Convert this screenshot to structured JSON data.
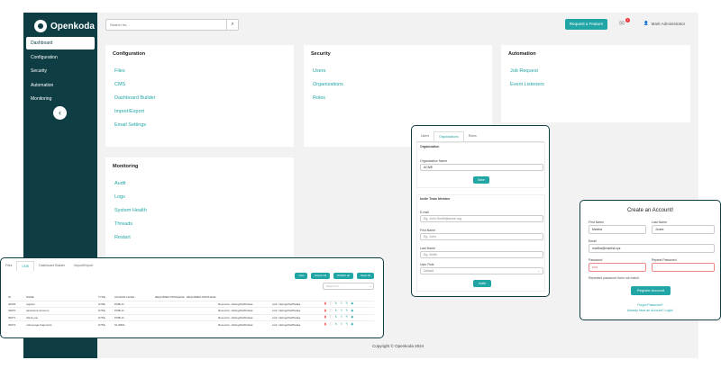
{
  "brand": {
    "name": "Openkoda"
  },
  "sidebar": {
    "items": [
      {
        "label": "Dashboard"
      },
      {
        "label": "Configuration"
      },
      {
        "label": "Security"
      },
      {
        "label": "Automation"
      },
      {
        "label": "Monitoring"
      }
    ],
    "collapse_icon": "chevron-left-icon"
  },
  "header": {
    "search_placeholder": "Search for...",
    "request_feature": "Request a Feature",
    "notification_count": "1",
    "user_name": "Mark Administrator"
  },
  "cards": {
    "configuration": {
      "title": "Configuration",
      "links": [
        "Files",
        "CMS",
        "Dashboard Builder",
        "Import/Export",
        "Email Settings"
      ]
    },
    "security": {
      "title": "Security",
      "links": [
        "Users",
        "Organizations",
        "Roles"
      ]
    },
    "automation": {
      "title": "Automation",
      "links": [
        "Job Request",
        "Event Listeners"
      ]
    },
    "monitoring": {
      "title": "Monitoring",
      "links": [
        "Audit",
        "Logs",
        "System Health",
        "Threads",
        "Restart"
      ]
    }
  },
  "footer": {
    "text": "Copyright © Openkoda 2024"
  },
  "org_panel": {
    "tabs": [
      "Users",
      "Organizations",
      "Roles"
    ],
    "section1_title": "Organization",
    "org_name_label": "Organization Name",
    "org_name_value": "ACME",
    "save": "Save",
    "section2_title": "Invite Team Member",
    "email_label": "E-mail",
    "email_placeholder": "Eg. John.Smith@acme.org",
    "first_name_label": "First Name",
    "first_name_placeholder": "Eg. John",
    "last_name_label": "Last Name",
    "last_name_placeholder": "Eg. Smith",
    "role_label": "User Role",
    "role_value": "Default",
    "invite": "Invite"
  },
  "register_panel": {
    "title": "Create an Account!",
    "first_name_label": "First Name",
    "first_name_value": "Martha",
    "last_name_label": "Last Name",
    "last_name_value": "Jones",
    "email_label": "Email",
    "email_value": "martha@martha.xyz",
    "password_label": "Password",
    "password_value": "•••••",
    "repeat_label": "Repeat Password",
    "error": "Repeated password does not match",
    "button": "Register Account",
    "forgot": "Forgot Password?",
    "login": "Already have an account? Login!"
  },
  "table_panel": {
    "tabs": [
      "Files",
      "CMS",
      "Dashboard Builder",
      "Import/Export"
    ],
    "actions": [
      "New",
      "Export All",
      "Publish all",
      "Clear All"
    ],
    "search_placeholder": "Search for...",
    "headers": [
      "ID",
      "NAME",
      "TYPE",
      "ACCESS LEVEL",
      "REQUIRED PRIVILEGE",
      "REQUIRED PRIVILEGE",
      "",
      ""
    ],
    "rows": [
      {
        "id": "30025",
        "name": "register",
        "type": "HTML",
        "access": "PUBLIC",
        "info": "Resource: /debug/tfsdfhsdaa",
        "link": "Link: /debug/tfsdfhsdaa"
      },
      {
        "id": "30070",
        "name": "password-recovery",
        "type": "HTML",
        "access": "PUBLIC",
        "info": "Resource: /debug/tfsdfhsdaa",
        "link": "Link: /debug/tfsdfhsdaa"
      },
      {
        "id": "30071",
        "name": "thank-you",
        "type": "HTML",
        "access": "PUBLIC",
        "info": "Resource: /debug/tfsdfhsdaa",
        "link": "Link: /debug/tfsdfhsdaa"
      },
      {
        "id": "30072",
        "name": "main-page-fragments",
        "type": "HTML",
        "access": "GLOBAL",
        "info": "Resource: /debug/tfsdfhsdaa",
        "link": "Link: /debug/tfsdfhsdaa"
      }
    ]
  },
  "colors": {
    "sidebar": "#0e3d44",
    "accent": "#21a5a5",
    "danger": "#e33"
  }
}
